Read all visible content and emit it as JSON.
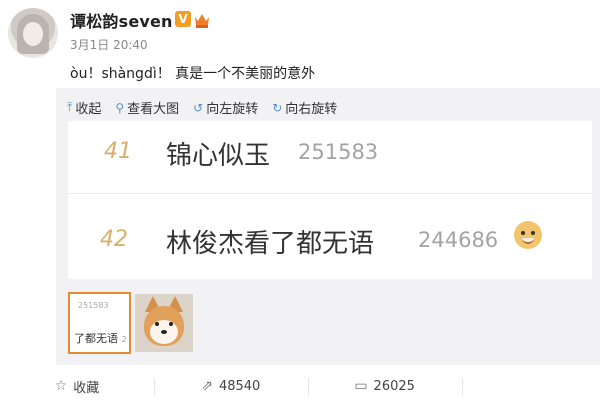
{
  "post": {
    "username": "谭松韵seven",
    "verified_badge": "V",
    "time": "3月1日 20:40",
    "text": "òu！shàngdì！ 真是一个不美丽的意外"
  },
  "toolbar": {
    "collapse": "收起",
    "view_large": "查看大图",
    "rotate_left": "向左旋转",
    "rotate_right": "向右旋转"
  },
  "image": {
    "rows": [
      {
        "rank": "41",
        "name": "锦心似玉",
        "score": "251583"
      },
      {
        "rank": "42",
        "name": "林俊杰看了都无语",
        "score": "244686"
      }
    ]
  },
  "thumbs": {
    "t1_num": "251583",
    "t1_text": "了都无语",
    "t1_suffix": "2"
  },
  "footer": {
    "favorite": "收藏",
    "repost_count": "48540",
    "comment_count": "26025"
  }
}
